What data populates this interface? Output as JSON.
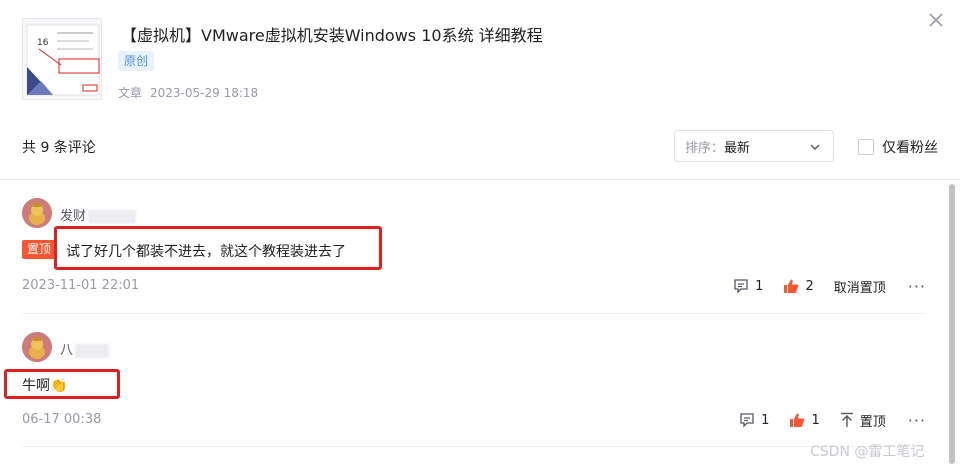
{
  "article": {
    "title": "【虚拟机】VMware虚拟机安装Windows 10系统 详细教程",
    "badge": "原创",
    "type": "文章",
    "date": "2023-05-29 18:18"
  },
  "toolbar": {
    "total": "共 9 条评论",
    "sort_label": "排序：",
    "sort_value": "最新",
    "fans_only": "仅看粉丝"
  },
  "comments": [
    {
      "user": "发财",
      "pin_badge": "置顶",
      "text": "试了好几个都装不进去，就这个教程装进去了",
      "time": "2023-11-01 22:01",
      "reply_count": "1",
      "like_count": "2",
      "pin_action": "取消置顶"
    },
    {
      "user": "八",
      "text": "牛啊",
      "emoji": "👏",
      "time": "06-17 00:38",
      "reply_count": "1",
      "like_count": "1",
      "pin_action": "置顶"
    }
  ],
  "more_label": "···",
  "watermark": "CSDN @雷工笔记",
  "colors": {
    "pin_badge": "#fc5531",
    "like": "#fc5531",
    "highlight_box": "#e0201f",
    "original_badge_text": "#5094d5"
  }
}
